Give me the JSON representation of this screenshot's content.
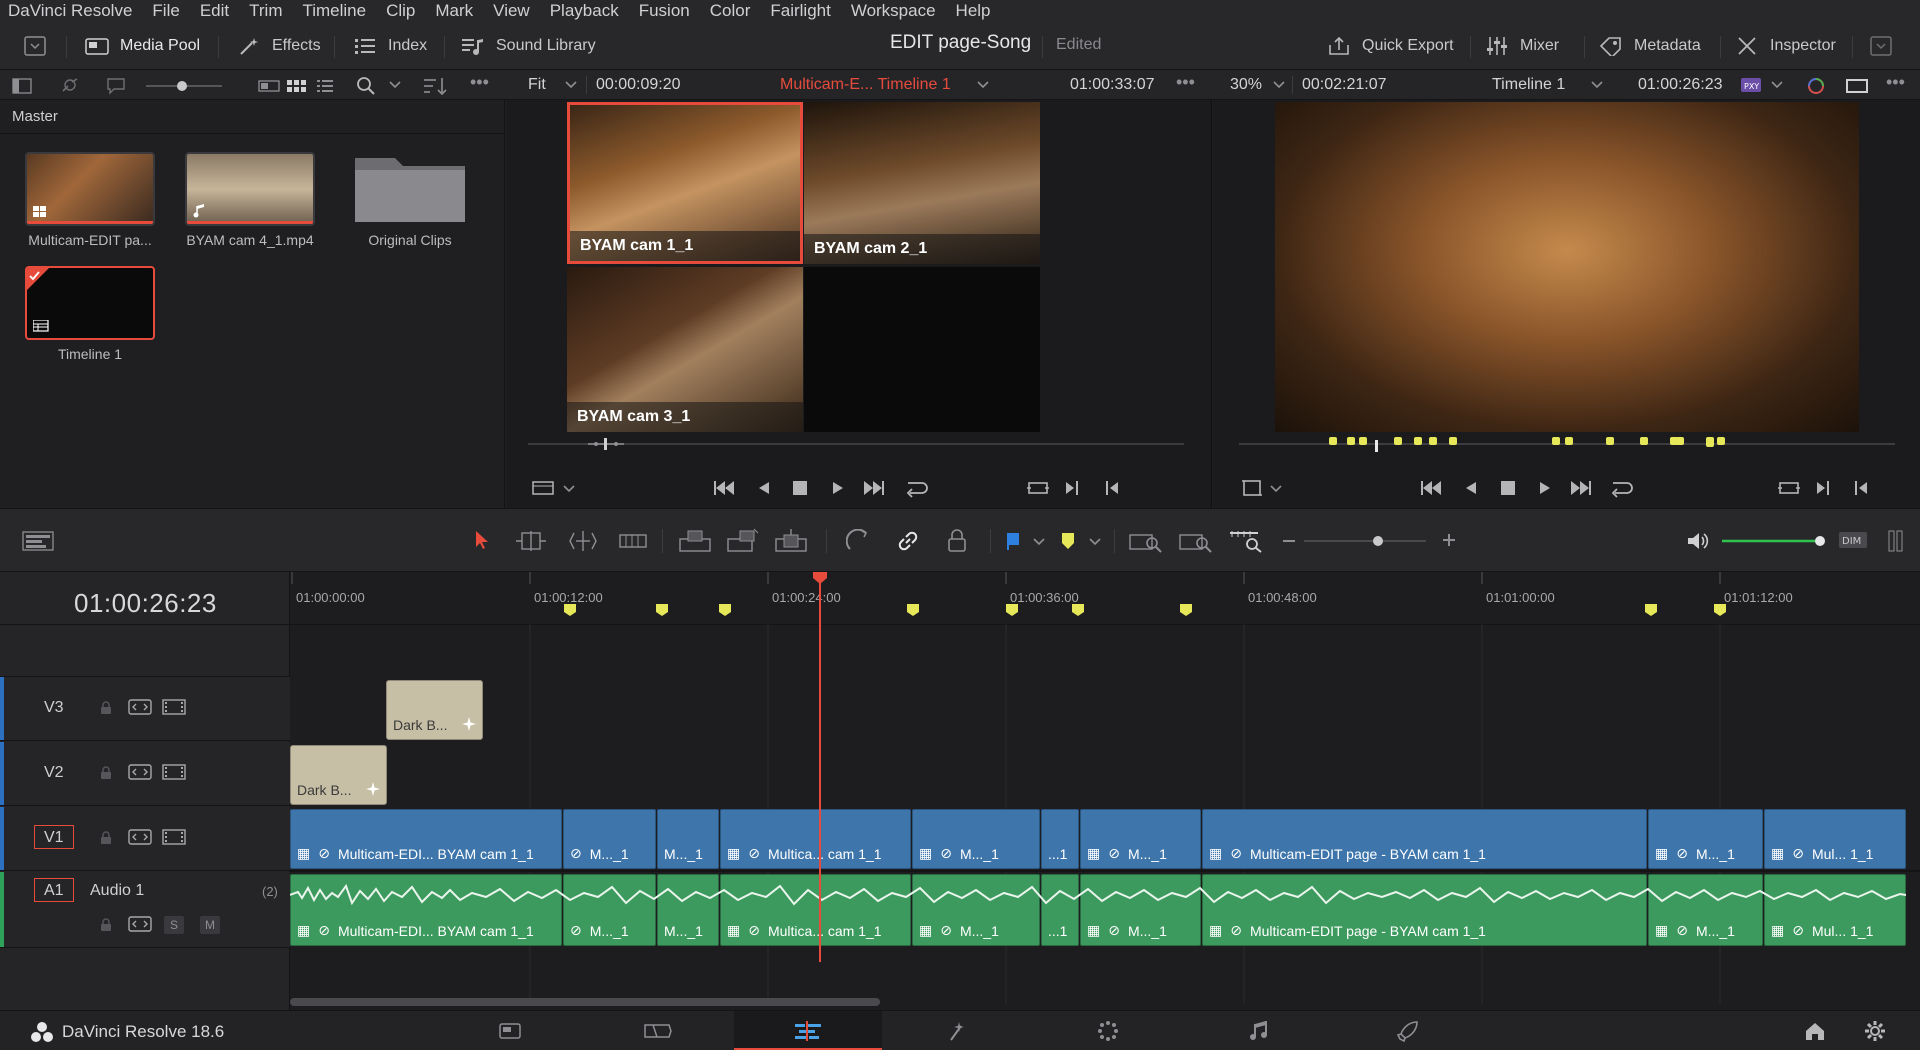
{
  "menu": [
    "DaVinci Resolve",
    "File",
    "Edit",
    "Trim",
    "Timeline",
    "Clip",
    "Mark",
    "View",
    "Playback",
    "Fusion",
    "Color",
    "Fairlight",
    "Workspace",
    "Help"
  ],
  "toolbar": {
    "media_pool": "Media Pool",
    "effects": "Effects",
    "index": "Index",
    "sound_library": "Sound Library",
    "project_title": "EDIT page-Song",
    "project_status": "Edited",
    "quick_export": "Quick Export",
    "mixer": "Mixer",
    "metadata": "Metadata",
    "inspector": "Inspector"
  },
  "source_bar": {
    "zoom": "Fit",
    "timecode_in": "00:00:09:20",
    "clip_title": "Multicam-E... Timeline 1",
    "timecode_out": "01:00:33:07"
  },
  "program_bar": {
    "zoom": "30%",
    "duration": "00:02:21:07",
    "timeline_name": "Timeline 1",
    "timecode": "01:00:26:23"
  },
  "media_pool": {
    "bin": "Master",
    "clips": [
      {
        "label": "Multicam-EDIT pa..."
      },
      {
        "label": "BYAM cam 4_1.mp4"
      },
      {
        "label": "Original Clips"
      },
      {
        "label": "Timeline 1"
      }
    ]
  },
  "multicam": {
    "angles": [
      "BYAM cam 1_1",
      "BYAM cam 2_1",
      "BYAM cam 3_1"
    ]
  },
  "timeline": {
    "timecode": "01:00:26:23",
    "ruler": [
      "01:00:00:00",
      "01:00:12:00",
      "01:00:24:00",
      "01:00:36:00",
      "01:00:48:00",
      "01:01:00:00",
      "01:01:12:00"
    ],
    "tracks": {
      "v3": "V3",
      "v2": "V2",
      "v1": "V1",
      "a1": "A1",
      "audio_name": "Audio 1",
      "audio_channels": "(2)",
      "solo": "S",
      "mute": "M"
    },
    "gen_clips": [
      "Dark B...",
      "Dark B..."
    ],
    "video_clips": [
      "Multicam-EDI... BYAM cam 1_1",
      "M..._1",
      "M..._1",
      "Multica... cam 1_1",
      "M..._1",
      "...1",
      "M..._1",
      "Multicam-EDIT page - BYAM cam 1_1",
      "M..._1",
      "Mul... 1_1"
    ],
    "audio_clips": [
      "Multicam-EDI... BYAM cam 1_1",
      "M..._1",
      "M..._1",
      "Multica... cam 1_1",
      "M..._1",
      "...1",
      "M..._1",
      "Multicam-EDIT page - BYAM cam 1_1",
      "M..._1",
      "Mul... 1_1"
    ]
  },
  "footer": {
    "brand": "DaVinci Resolve 18.6"
  },
  "colors": {
    "accent_red": "#e64b3c",
    "marker_yellow": "#e6e85a",
    "video_clip": "#3e76ab",
    "audio_clip": "#3d9a5e"
  }
}
